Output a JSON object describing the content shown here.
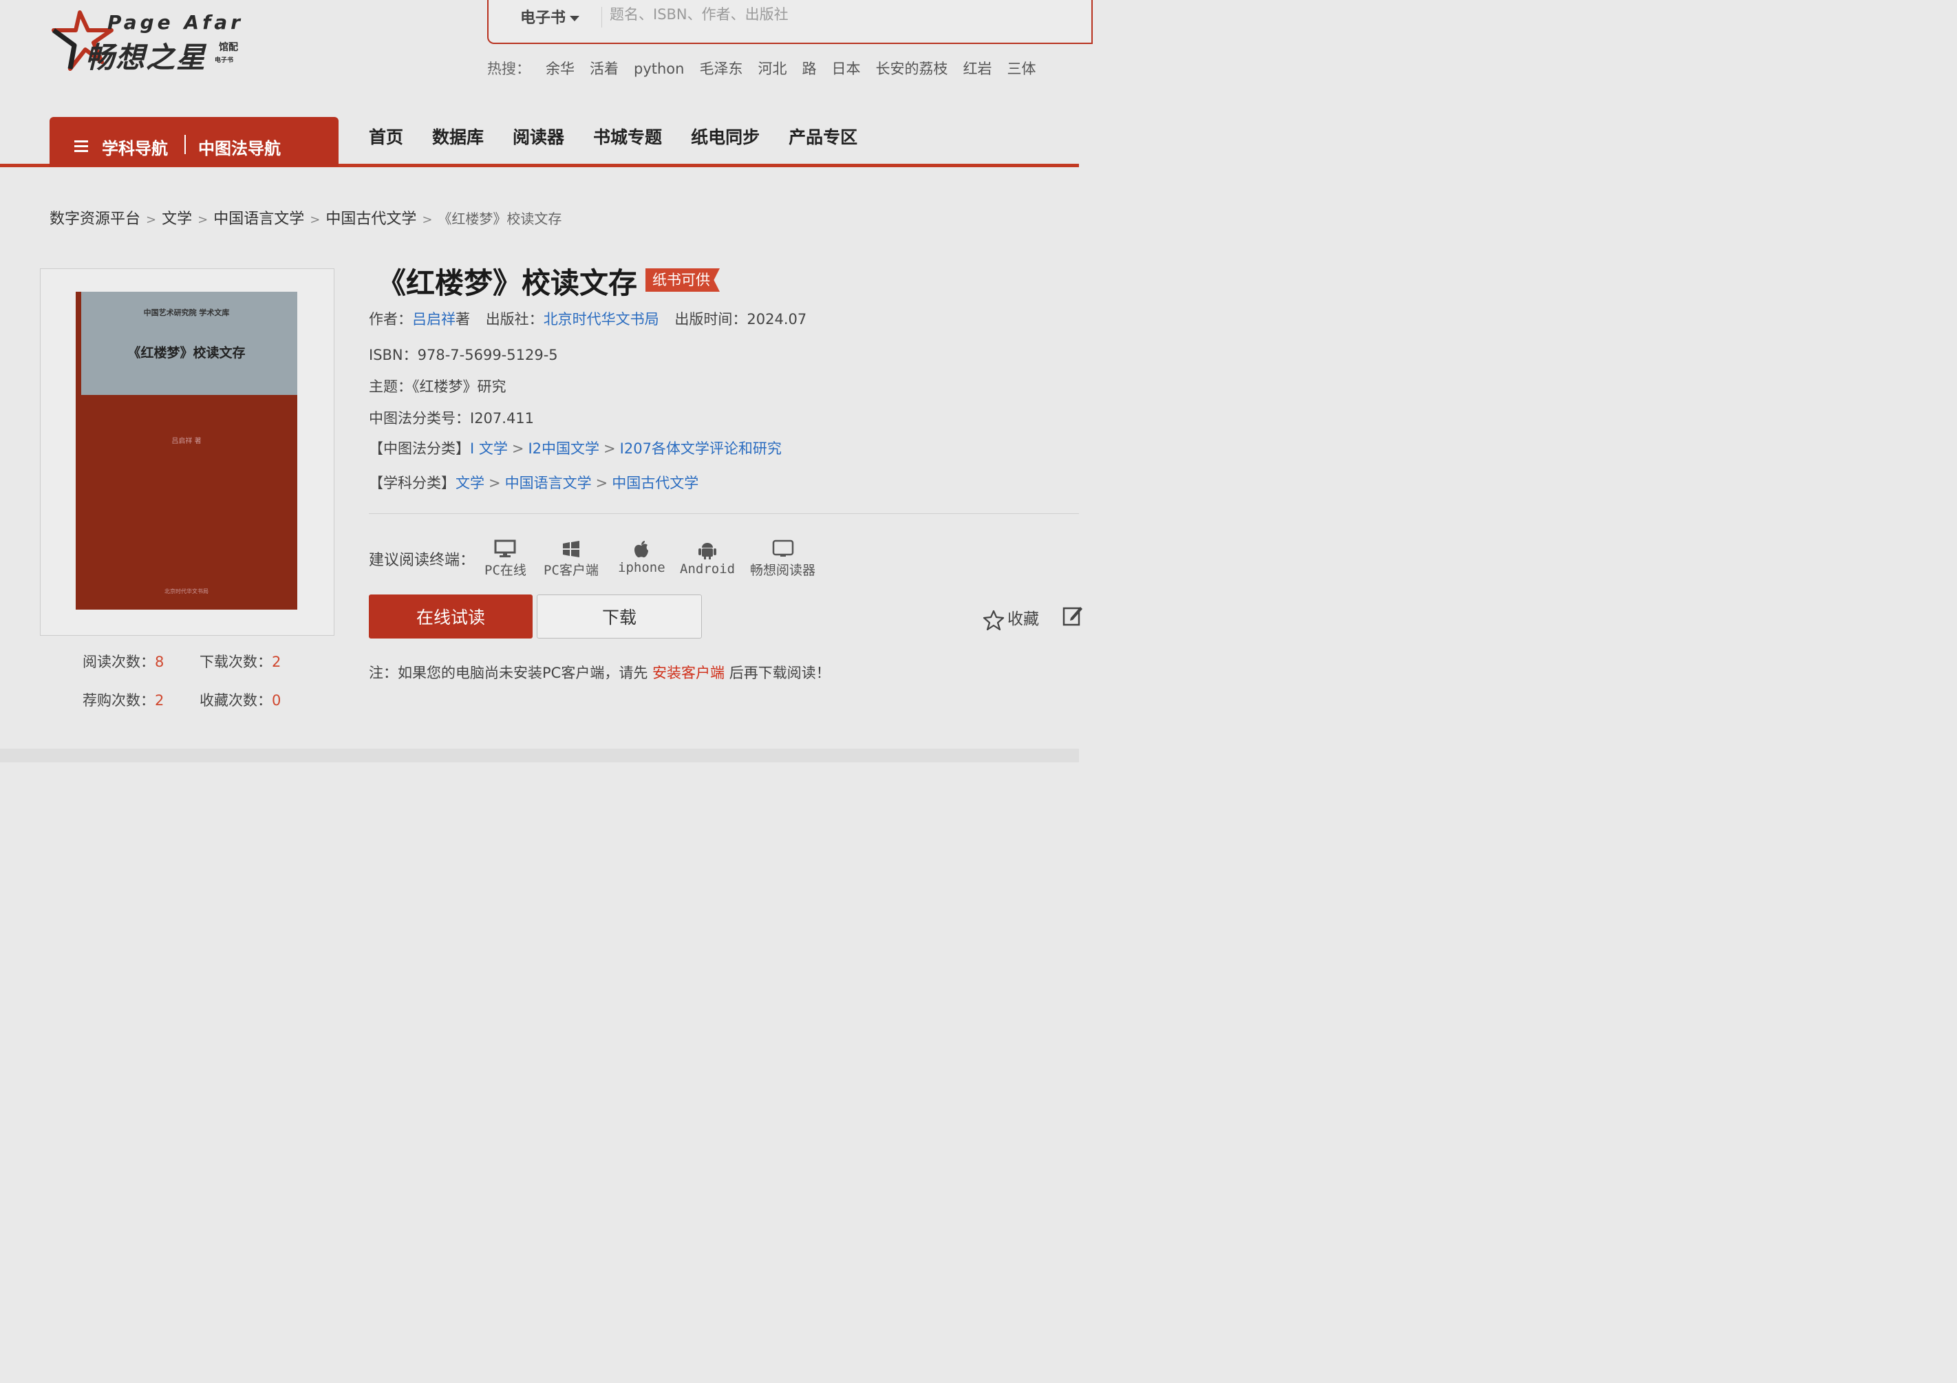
{
  "logo": {
    "en": "Page Afar",
    "cn": "畅想之星",
    "tag1": "馆配",
    "tag2": "电子书"
  },
  "search": {
    "type": "电子书",
    "placeholder": "题名、ISBN、作者、出版社"
  },
  "hot": {
    "label": "热搜：",
    "terms": [
      "余华",
      "活着",
      "python",
      "毛泽东",
      "河北",
      "路",
      "日本",
      "长安的荔枝",
      "红岩",
      "三体"
    ]
  },
  "catnav": {
    "subject": "学科导航",
    "clc": "中图法导航"
  },
  "mainnav": [
    "首页",
    "数据库",
    "阅读器",
    "书城专题",
    "纸电同步",
    "产品专区"
  ],
  "breadcrumb": {
    "items": [
      "数字资源平台",
      "文学",
      "中国语言文学",
      "中国古代文学"
    ],
    "current": "《红楼梦》校读文存"
  },
  "cover": {
    "publisher_line": "中国艺术研究院 学术文库",
    "title": "《红楼梦》校读文存",
    "author": "吕启祥 著",
    "press": "北京时代华文书局"
  },
  "stats": {
    "read_label": "阅读次数：",
    "read": "8",
    "download_label": "下载次数：",
    "download": "2",
    "recommend_label": "荐购次数：",
    "recommend": "2",
    "favorite_label": "收藏次数：",
    "favorite": "0"
  },
  "book": {
    "title": "《红楼梦》校读文存",
    "badge": "纸书可供",
    "author_label": "作者：",
    "author": "吕启祥",
    "author_suffix": "著",
    "publisher_label": "出版社：",
    "publisher": "北京时代华文书局",
    "pubdate_label": "出版时间：",
    "pubdate": "2024.07",
    "isbn_label": "ISBN：",
    "isbn": "978-7-5699-5129-5",
    "subject_label": "主题：",
    "subject": "《红楼梦》研究",
    "clc_label": "中图法分类号：",
    "clc": "I207.411",
    "clc_path_label": "【中图法分类】",
    "clc_path": [
      "I 文学",
      "I2中国文学",
      "I207各体文学评论和研究"
    ],
    "discipline_label": "【学科分类】",
    "discipline_path": [
      "文学",
      "中国语言文学",
      "中国古代文学"
    ]
  },
  "terminals": {
    "label": "建议阅读终端：",
    "items": [
      "PC在线",
      "PC客户端",
      "iphone",
      "Android",
      "畅想阅读器"
    ]
  },
  "actions": {
    "read": "在线试读",
    "download": "下载",
    "favorite": "收藏"
  },
  "note": {
    "prefix": "注：如果您的电脑尚未安装PC客户端，请先",
    "link": "安装客户端",
    "suffix": "后再下载阅读！"
  },
  "colors": {
    "brand_red": "#b8321f",
    "link_blue": "#2a6cc0",
    "stat_red": "#d0472e"
  }
}
